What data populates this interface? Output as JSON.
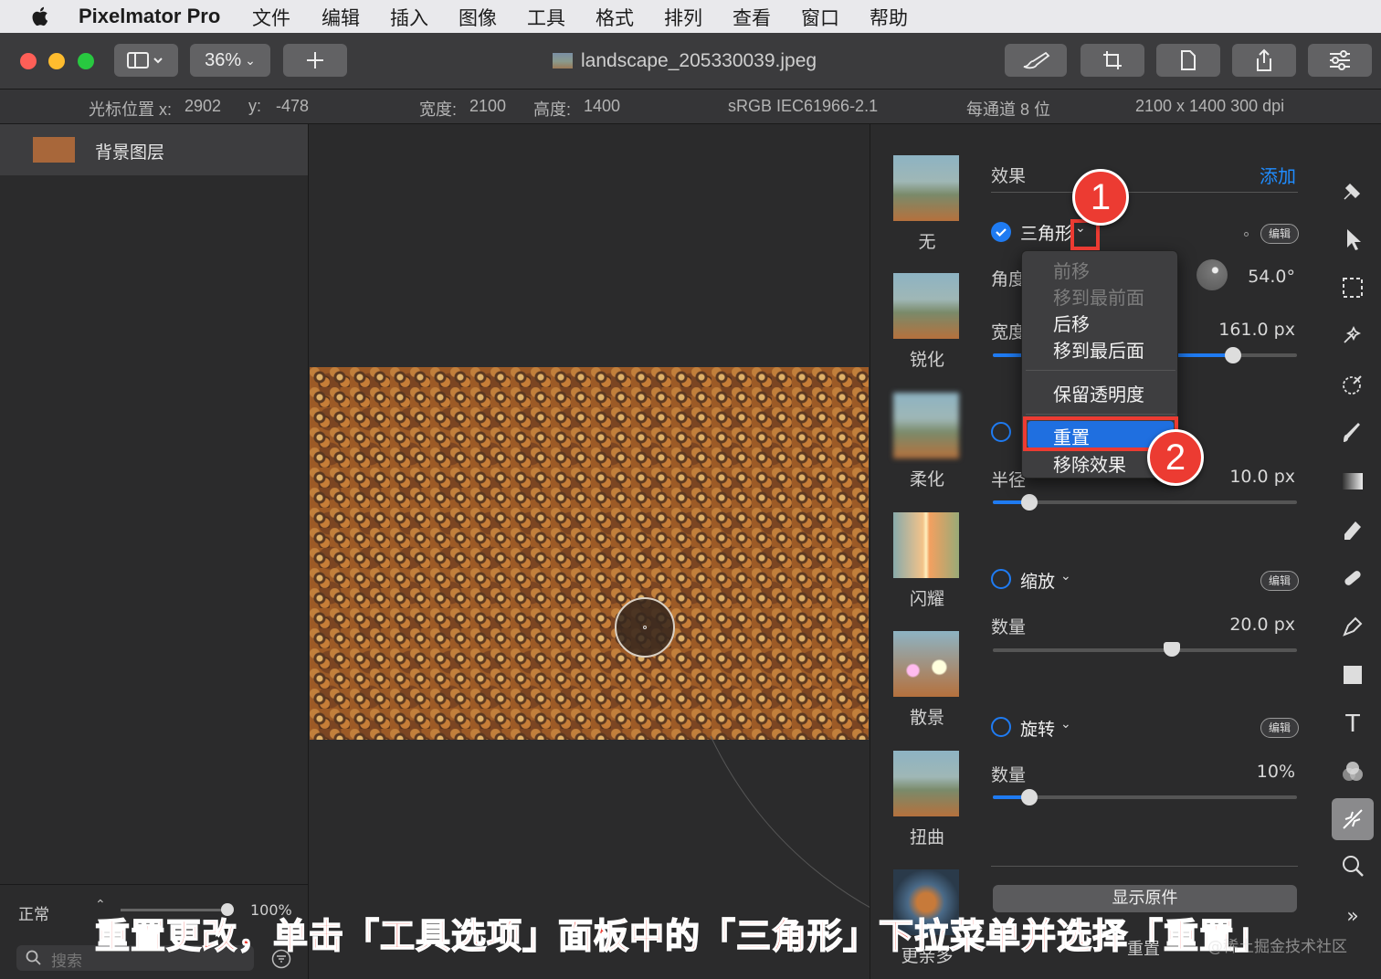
{
  "menubar": {
    "app_name": "Pixelmator Pro",
    "items": [
      "文件",
      "编辑",
      "插入",
      "图像",
      "工具",
      "格式",
      "排列",
      "查看",
      "窗口",
      "帮助"
    ]
  },
  "toolbar": {
    "zoom": "36%",
    "document_title": "landscape_205330039.jpeg"
  },
  "infobar": {
    "cursor_x_label": "光标位置 x:",
    "cursor_x": "2902",
    "cursor_y_label": "y:",
    "cursor_y": "-478",
    "width_label": "宽度:",
    "width": "2100",
    "height_label": "高度:",
    "height": "1400",
    "color_profile": "sRGB IEC61966-2.1",
    "bit_depth": "每通道 8 位",
    "size_dpi": "2100 x 1400 300 dpi"
  },
  "layers": {
    "layer_name": "背景图层",
    "blend_mode": "正常",
    "opacity": "100%",
    "search_placeholder": "搜索"
  },
  "presets": [
    "无",
    "锐化",
    "柔化",
    "闪耀",
    "散景",
    "扭曲",
    "更亲多"
  ],
  "effects": {
    "header": "效果",
    "add_label": "添加",
    "edit_label": "编辑",
    "triangle": {
      "name": "三角形",
      "angle_label": "角度",
      "angle_value": "54.0°",
      "width_label": "宽度",
      "width_value": "161.0 px",
      "width_fraction": 0.79
    },
    "blur": {
      "radius_label": "半径",
      "radius_value": "10.0 px",
      "radius_fraction": 0.12
    },
    "zoom": {
      "name": "缩放",
      "amount_label": "数量",
      "amount_value": "20.0 px",
      "amount_fraction": 0.59
    },
    "rotate": {
      "name": "旋转",
      "amount_label": "数量",
      "amount_value": "10%",
      "amount_fraction": 0.12
    },
    "show_original": "显示原件",
    "reset_bottom": "重置"
  },
  "popup_menu": {
    "items": [
      {
        "label": "前移",
        "enabled": false
      },
      {
        "label": "移到最前面",
        "enabled": false
      },
      {
        "label": "后移",
        "enabled": true
      },
      {
        "label": "移到最后面",
        "enabled": true
      },
      {
        "label": "保留透明度",
        "enabled": true
      },
      {
        "label": "重置",
        "enabled": true,
        "highlighted": true
      },
      {
        "label": "移除效果",
        "enabled": true
      }
    ]
  },
  "annotations": {
    "badge_1": "1",
    "badge_2": "2",
    "caption": "重置更改，单击「工具选项」面板中的「三角形」下拉菜单并选择「重置」",
    "watermark": "@稀土掘金技术社区"
  },
  "colors": {
    "accent": "#1f7bf2",
    "annotation_red": "#ec3b32",
    "close": "#fe5f57",
    "minimize": "#febc2e",
    "zoom": "#28c840"
  },
  "icons": [
    "apple-icon",
    "sidebar-toggle-icon",
    "plus-icon",
    "brush-icon",
    "crop-icon",
    "document-icon",
    "share-icon",
    "sliders-icon",
    "arrange-icon",
    "pointer-icon",
    "select-rect-icon",
    "magic-select-icon",
    "color-pick-icon",
    "paint-brush-icon",
    "gradient-icon",
    "eraser-icon",
    "repair-icon",
    "pen-icon",
    "shape-icon",
    "text-icon",
    "color-adjust-icon",
    "effects-icon",
    "zoom-tool-icon",
    "expand-icon",
    "search-icon",
    "filter-icon"
  ]
}
